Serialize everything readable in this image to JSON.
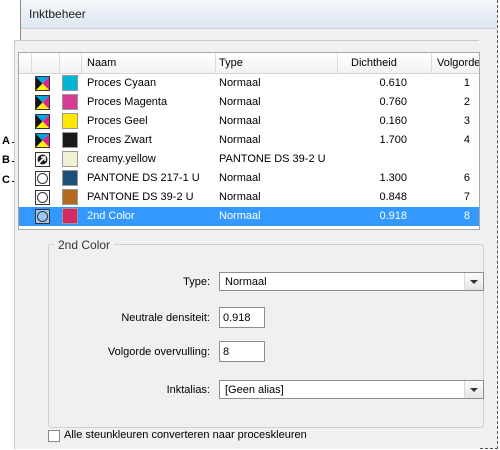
{
  "window": {
    "title": "Inktbeheer"
  },
  "list": {
    "columns": [
      "Naam",
      "Type",
      "Dichtheid",
      "Volgorde"
    ],
    "rows": [
      {
        "name": "Proces Cyaan",
        "type": "Normaal",
        "density": "0.610",
        "order": "1",
        "color": "#00b5d8",
        "icon": "process-ink-icon"
      },
      {
        "name": "Proces Magenta",
        "type": "Normaal",
        "density": "0.760",
        "order": "2",
        "color": "#d63b95",
        "icon": "process-ink-icon"
      },
      {
        "name": "Proces Geel",
        "type": "Normaal",
        "density": "0.160",
        "order": "3",
        "color": "#ffe800",
        "icon": "process-ink-icon"
      },
      {
        "name": "Proces Zwart",
        "type": "Normaal",
        "density": "1.700",
        "order": "4",
        "color": "#1a1a1a",
        "icon": "process-ink-icon"
      },
      {
        "name": "creamy.yellow",
        "type": "PANTONE DS 39-2 U",
        "density": "",
        "order": "",
        "color": "#f4f0d6",
        "icon": "ink-alias-icon"
      },
      {
        "name": "PANTONE DS 217-1 U",
        "type": "Normaal",
        "density": "1.300",
        "order": "6",
        "color": "#1d4f7a",
        "icon": "spot-ink-icon"
      },
      {
        "name": "PANTONE DS 39-2 U",
        "type": "Normaal",
        "density": "0.848",
        "order": "7",
        "color": "#b36a1e",
        "icon": "spot-ink-icon"
      },
      {
        "name": "2nd Color",
        "type": "Normaal",
        "density": "0.918",
        "order": "8",
        "color": "#d22b63",
        "icon": "spot-ink-icon",
        "selected": true
      }
    ]
  },
  "callouts": {
    "a": "A",
    "b": "B",
    "c": "C"
  },
  "details": {
    "group_title": "2nd Color",
    "type_label": "Type:",
    "type_value": "Normaal",
    "density_label": "Neutrale densiteit:",
    "density_value": "0.918",
    "order_label": "Volgorde overvulling:",
    "order_value": "8",
    "alias_label": "Inktalias:",
    "alias_value": "[Geen alias]"
  },
  "convert_all_label": "Alle steunkleuren converteren naar proceskleuren",
  "colors": {
    "selection": "#3399ff"
  }
}
